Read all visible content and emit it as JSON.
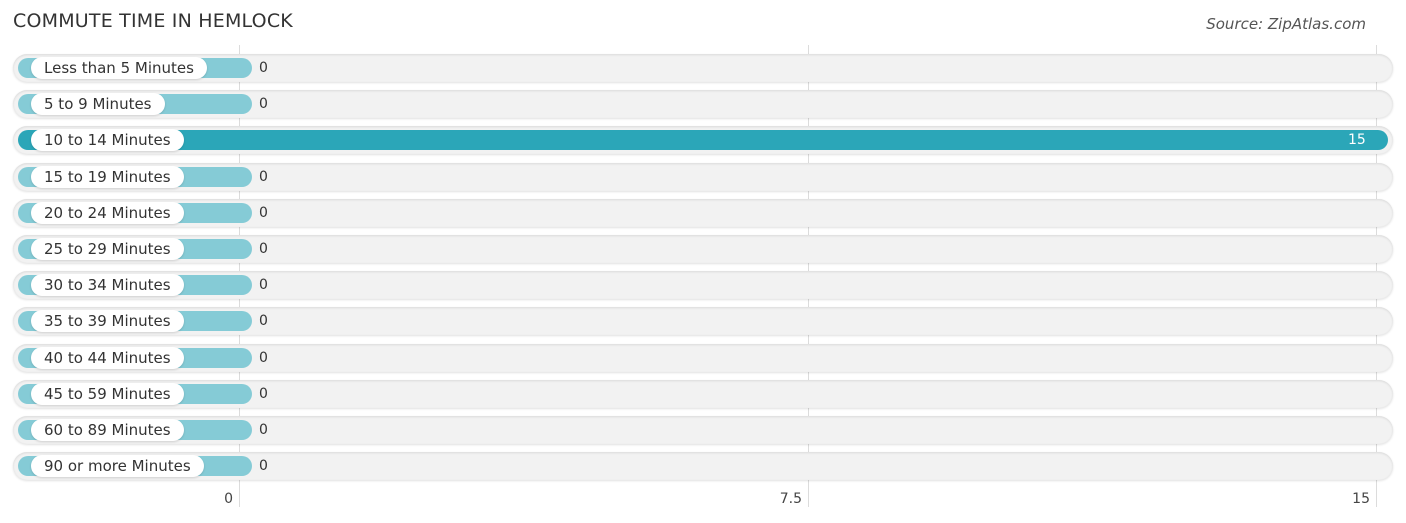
{
  "header": {
    "title": "COMMUTE TIME IN HEMLOCK",
    "source": "Source: ZipAtlas.com"
  },
  "colors": {
    "bar_highlight": "#2ba6b8",
    "bar_default": "#85cbd6",
    "track": "#f2f2f2",
    "grid": "#dcdcdc"
  },
  "chart_data": {
    "type": "bar",
    "orientation": "horizontal",
    "title": "COMMUTE TIME IN HEMLOCK",
    "xlabel": "",
    "ylabel": "",
    "categories": [
      "Less than 5 Minutes",
      "5 to 9 Minutes",
      "10 to 14 Minutes",
      "15 to 19 Minutes",
      "20 to 24 Minutes",
      "25 to 29 Minutes",
      "30 to 34 Minutes",
      "35 to 39 Minutes",
      "40 to 44 Minutes",
      "45 to 59 Minutes",
      "60 to 89 Minutes",
      "90 or more Minutes"
    ],
    "values": [
      0,
      0,
      15,
      0,
      0,
      0,
      0,
      0,
      0,
      0,
      0,
      0
    ],
    "value_labels": [
      "0",
      "0",
      "15",
      "0",
      "0",
      "0",
      "0",
      "0",
      "0",
      "0",
      "0",
      "0"
    ],
    "xlim": [
      0,
      15
    ],
    "ticks": [
      0,
      7.5,
      15
    ],
    "tick_labels": [
      "0",
      "7.5",
      "15"
    ],
    "grid": true,
    "legend": "none"
  }
}
